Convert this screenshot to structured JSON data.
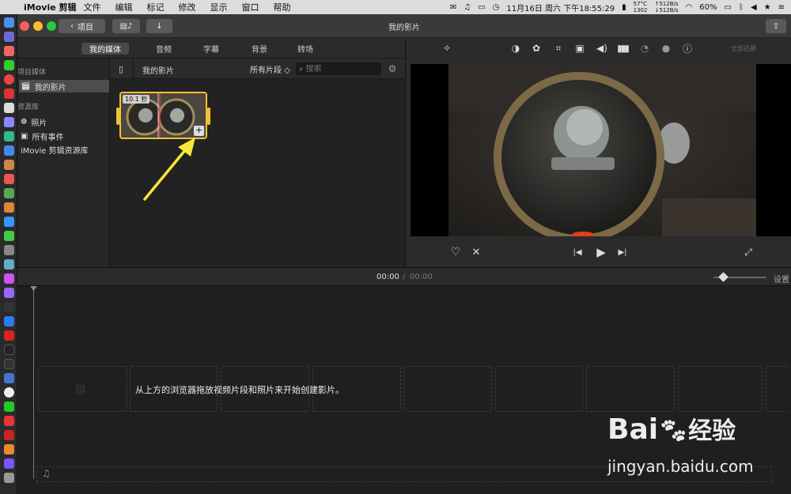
{
  "menubar": {
    "app_name": "iMovie 剪辑",
    "items": [
      "文件",
      "编辑",
      "标记",
      "修改",
      "显示",
      "窗口",
      "帮助"
    ],
    "temp": "57°C",
    "rpm": "1302",
    "net_up": "↑512B/s",
    "net_down": "↓512B/s",
    "datetime": "11月16日 周六 下午18:55:29",
    "battery": "60%"
  },
  "window": {
    "title": "我的影片",
    "back_label": "项目"
  },
  "tabs": [
    "我的媒体",
    "音频",
    "字幕",
    "背景",
    "转场"
  ],
  "sidebar": {
    "section1": "项目媒体",
    "project_item": "我的影片",
    "section2": "资源库",
    "items": [
      "照片",
      "所有事件",
      "iMovie 剪辑资源库"
    ]
  },
  "browser": {
    "title": "我的影片",
    "filter": "所有片段 ◇",
    "search_placeholder": "搜索",
    "clip_duration": "10.1 秒"
  },
  "viewer": {
    "reset_label": "全部还原"
  },
  "timeline": {
    "current_time": "00:00",
    "separator": "/",
    "total_time": "00:00",
    "settings_label": "设置",
    "hint": "从上方的浏览器拖放视频片段和照片来开始创建影片。"
  },
  "watermark": {
    "brand": "Bai",
    "brand2": "经验",
    "url": "jingyan.baidu.com"
  },
  "colors": {
    "accent_yellow": "#f2c230",
    "arrow_yellow": "#f5e63a"
  }
}
